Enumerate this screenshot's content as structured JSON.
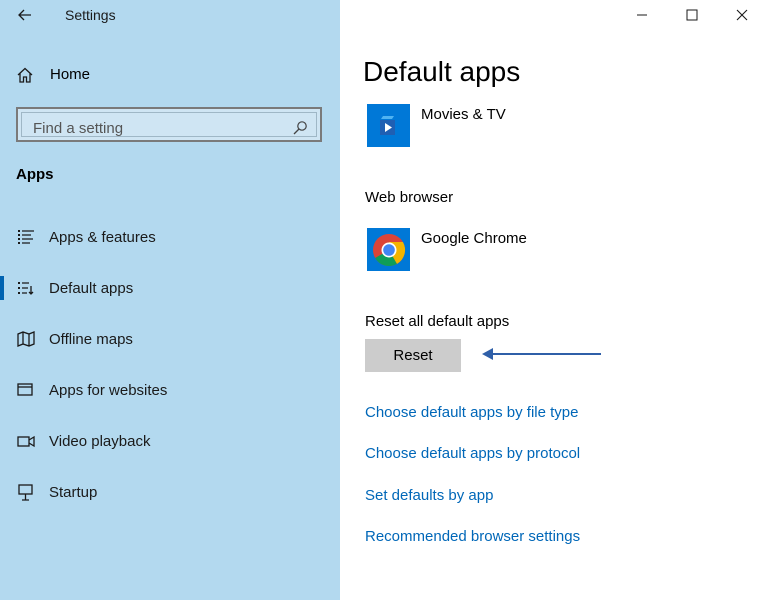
{
  "window": {
    "title": "Settings",
    "controls": [
      "minimize",
      "maximize",
      "close"
    ]
  },
  "sidebar": {
    "home_label": "Home",
    "search": {
      "placeholder": "Find a setting"
    },
    "section_title": "Apps",
    "items": [
      {
        "label": "Apps & features",
        "icon": "list-icon",
        "active": false
      },
      {
        "label": "Default apps",
        "icon": "default-apps-icon",
        "active": true
      },
      {
        "label": "Offline maps",
        "icon": "map-icon",
        "active": false
      },
      {
        "label": "Apps for websites",
        "icon": "link-window-icon",
        "active": false
      },
      {
        "label": "Video playback",
        "icon": "video-icon",
        "active": false
      },
      {
        "label": "Startup",
        "icon": "startup-icon",
        "active": false
      }
    ]
  },
  "main": {
    "title": "Default apps",
    "video_player": {
      "app_name": "Movies & TV",
      "icon": "movies-tv-icon"
    },
    "web_browser": {
      "label": "Web browser",
      "app_name": "Google Chrome",
      "icon": "chrome-icon"
    },
    "reset": {
      "label": "Reset all default apps",
      "button_label": "Reset"
    },
    "links": [
      "Choose default apps by file type",
      "Choose default apps by protocol",
      "Set defaults by app",
      "Recommended browser settings"
    ]
  },
  "colors": {
    "sidebar_bg": "#b3d9ef",
    "accent": "#0067b8",
    "button_bg": "#cccccc",
    "arrow": "#2f5fa8"
  }
}
